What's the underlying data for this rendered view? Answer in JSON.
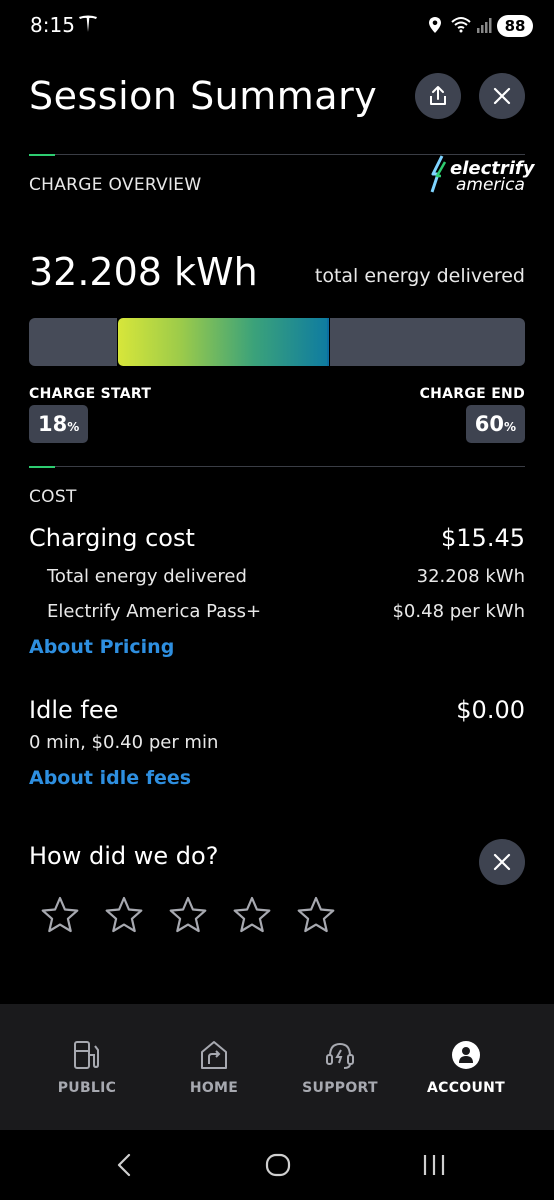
{
  "status": {
    "time": "8:15",
    "battery": "88",
    "wifi_label": "6"
  },
  "header": {
    "title": "Session Summary"
  },
  "overview": {
    "section_title": "CHARGE OVERVIEW",
    "logo_line1": "electrify",
    "logo_line2": "america",
    "energy_value": "32.208 kWh",
    "energy_caption": "total energy delivered",
    "charge_start_label": "CHARGE START",
    "charge_start_value": "18",
    "charge_end_label": "CHARGE END",
    "charge_end_value": "60",
    "percent_sign": "%",
    "start_fraction": 0.18,
    "end_fraction": 0.6
  },
  "cost": {
    "section_title": "COST",
    "charging_cost_label": "Charging cost",
    "charging_cost_value": "$15.45",
    "energy_label": "Total energy delivered",
    "energy_value": "32.208 kWh",
    "plan_label": "Electrify America Pass+",
    "plan_value": "$0.48 per kWh",
    "pricing_link": "About Pricing",
    "idle_label": "Idle fee",
    "idle_value": "$0.00",
    "idle_detail": "0 min, $0.40 per min",
    "idle_link": "About idle fees"
  },
  "rating": {
    "question": "How did we do?",
    "stars": 5,
    "selected": 0
  },
  "nav": {
    "items": [
      {
        "label": "PUBLIC",
        "icon": "charger-station-icon"
      },
      {
        "label": "HOME",
        "icon": "home-charging-icon"
      },
      {
        "label": "SUPPORT",
        "icon": "support-headset-icon"
      },
      {
        "label": "ACCOUNT",
        "icon": "account-icon"
      }
    ],
    "active": "ACCOUNT"
  },
  "colors": {
    "accent": "#2ecc71",
    "link": "#2e8fe0",
    "button_bg": "#3e4350"
  }
}
